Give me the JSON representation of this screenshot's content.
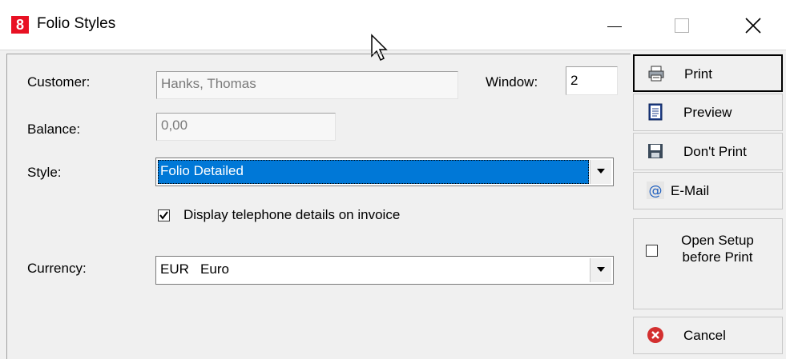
{
  "window": {
    "app_icon": "8",
    "title": "Folio Styles"
  },
  "form": {
    "customer_label": "Customer:",
    "customer_value": "Hanks, Thomas",
    "window_label": "Window:",
    "window_value": "2",
    "balance_label": "Balance:",
    "balance_value": "0,00",
    "style_label": "Style:",
    "style_value": "Folio Detailed",
    "display_phone_label": "Display telephone details on invoice",
    "display_phone_checked": true,
    "currency_label": "Currency:",
    "currency_value": "EUR   Euro"
  },
  "buttons": {
    "print": "Print",
    "preview": "Preview",
    "dont_print": "Don't Print",
    "email": "E-Mail",
    "open_setup": "Open Setup before Print",
    "open_setup_checked": false,
    "cancel": "Cancel"
  },
  "icons": {
    "app": "app-logo-icon",
    "minimize": "minimize-icon",
    "maximize": "maximize-icon",
    "close": "close-icon",
    "print": "printer-icon",
    "preview": "document-icon",
    "dont_print": "floppy-disk-icon",
    "email": "at-sign-icon",
    "cancel": "cancel-circle-icon"
  },
  "colors": {
    "selection": "#0078d7",
    "app_icon": "#e81123",
    "cancel_icon": "#d32f2f"
  }
}
